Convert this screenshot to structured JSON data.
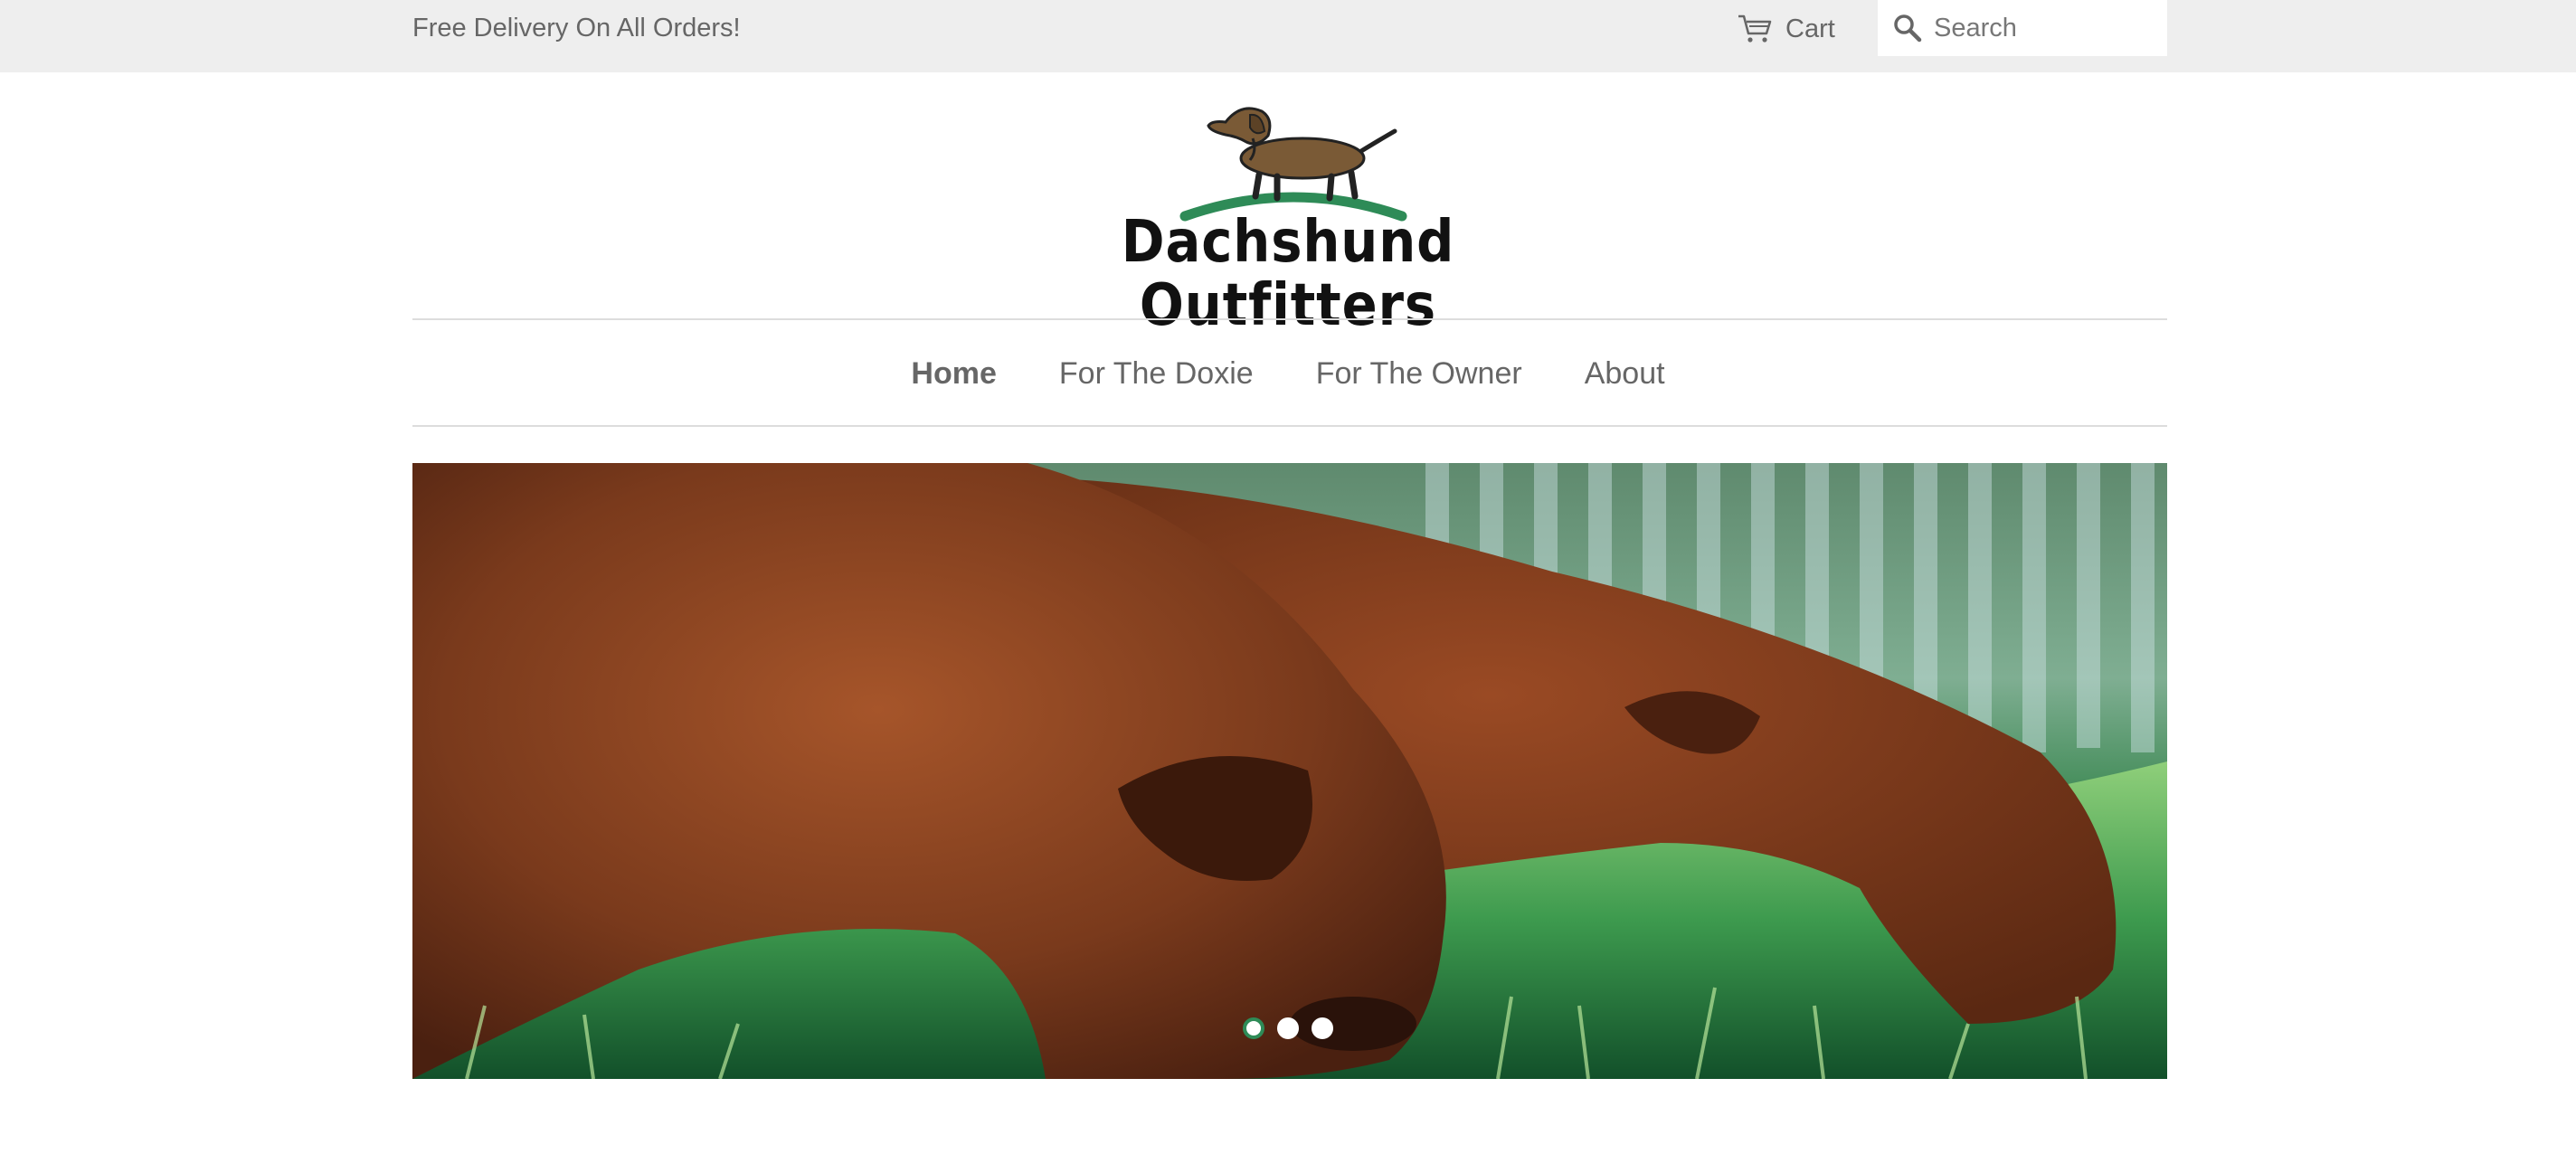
{
  "announcement": {
    "text": "Free Delivery On All Orders!"
  },
  "header": {
    "cart_label": "Cart",
    "search_placeholder": "Search"
  },
  "logo": {
    "text": "Dachshund Outfitters",
    "icon": "dachshund-logo"
  },
  "nav": {
    "items": [
      {
        "label": "Home",
        "active": true
      },
      {
        "label": "For The Doxie",
        "active": false
      },
      {
        "label": "For The Owner",
        "active": false
      },
      {
        "label": "About",
        "active": false
      }
    ]
  },
  "slideshow": {
    "slide_count": 3,
    "active_index": 0,
    "image": "two-dachshunds-sniffing-grass"
  },
  "colors": {
    "announcement_bg": "#eeeeee",
    "text": "#666666",
    "accent_green": "#2e8b57",
    "divider": "#dddddd"
  }
}
